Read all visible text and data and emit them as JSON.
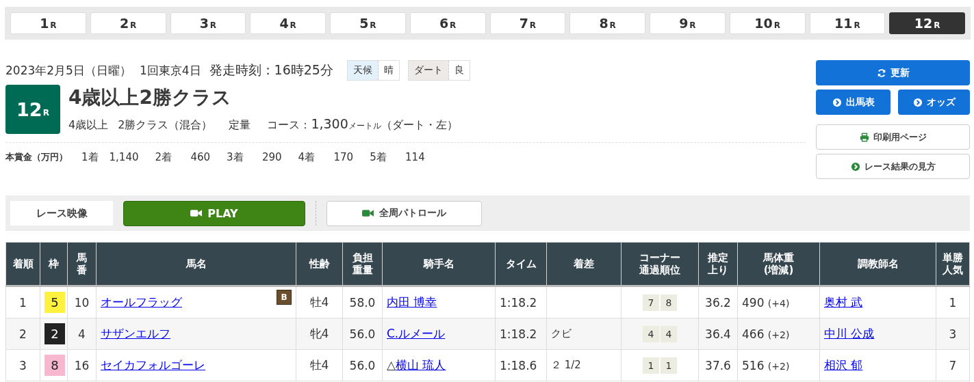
{
  "race_tabs": [
    {
      "number": "1",
      "suffix": "R",
      "selected": false
    },
    {
      "number": "2",
      "suffix": "R",
      "selected": false
    },
    {
      "number": "3",
      "suffix": "R",
      "selected": false
    },
    {
      "number": "4",
      "suffix": "R",
      "selected": false
    },
    {
      "number": "5",
      "suffix": "R",
      "selected": false
    },
    {
      "number": "6",
      "suffix": "R",
      "selected": false
    },
    {
      "number": "7",
      "suffix": "R",
      "selected": false
    },
    {
      "number": "8",
      "suffix": "R",
      "selected": false
    },
    {
      "number": "9",
      "suffix": "R",
      "selected": false
    },
    {
      "number": "10",
      "suffix": "R",
      "selected": false
    },
    {
      "number": "11",
      "suffix": "R",
      "selected": false
    },
    {
      "number": "12",
      "suffix": "R",
      "selected": true
    }
  ],
  "race_info": {
    "date": "2023年2月5日（日曜）",
    "meeting": "1回東京4日",
    "start_time": "発走時刻：16時25分",
    "weather": {
      "label": "天候",
      "value": "晴"
    },
    "track": {
      "label": "ダート",
      "value": "良"
    },
    "race_number": {
      "number": "12",
      "suffix": "R"
    },
    "race_name": "4歳以上2勝クラス",
    "conditions": [
      "4歳以上",
      "2勝クラス（混合）",
      "定量"
    ],
    "course": {
      "label": "コース：",
      "distance": "1,300",
      "unit": "メートル",
      "detail": "（ダート・左）"
    },
    "prize_label": "本賞金（万円）",
    "prizes": [
      {
        "place": "1着",
        "amount": "1,140"
      },
      {
        "place": "2着",
        "amount": "460"
      },
      {
        "place": "3着",
        "amount": "290"
      },
      {
        "place": "4着",
        "amount": "170"
      },
      {
        "place": "5着",
        "amount": "114"
      }
    ]
  },
  "side_buttons": [
    {
      "label": "更新",
      "kind": "refresh"
    },
    {
      "label": "出馬表",
      "kind": "link"
    },
    {
      "label": "オッズ",
      "kind": "link"
    },
    {
      "label": "印刷用ページ",
      "kind": "print"
    },
    {
      "label": "レース結果の見方",
      "kind": "guide"
    }
  ],
  "video": {
    "label": "レース映像",
    "play": "PLAY",
    "patrol": "全周パトロール"
  },
  "table": {
    "columns": [
      [
        "着順"
      ],
      [
        "枠"
      ],
      [
        "馬",
        "番"
      ],
      [
        "馬名"
      ],
      [
        "性齢"
      ],
      [
        "負担",
        "重量"
      ],
      [
        "騎手名"
      ],
      [
        "タイム"
      ],
      [
        "着差"
      ],
      [
        "コーナー",
        "通過順位"
      ],
      [
        "推定",
        "上り"
      ],
      [
        "馬体重",
        "(増減)"
      ],
      [
        "調教師名"
      ],
      [
        "単勝",
        "人気"
      ]
    ],
    "rows": [
      {
        "place": "1",
        "frame": "5",
        "color": "#fff23e",
        "number": "10",
        "horse": "オールフラッグ",
        "blinkers": "B",
        "sex_age": "牡4",
        "weight": "58.0",
        "jockey_mark": "",
        "jockey": "内田 博幸",
        "time": "1:18.2",
        "margin": "",
        "corners": [
          "7",
          "8"
        ],
        "last3f": "36.2",
        "body_weight": "490",
        "weight_change": "(+4)",
        "trainer": "奥村 武",
        "popularity": "1"
      },
      {
        "place": "2",
        "frame": "2",
        "color": "#222222",
        "number": "4",
        "horse": "サザンエルフ",
        "blinkers": "",
        "sex_age": "牝4",
        "weight": "56.0",
        "jockey_mark": "",
        "jockey": "C.ルメール",
        "time": "1:18.2",
        "margin": "クビ",
        "corners": [
          "4",
          "4"
        ],
        "last3f": "36.4",
        "body_weight": "466",
        "weight_change": "(+2)",
        "trainer": "中川 公成",
        "popularity": "3"
      },
      {
        "place": "3",
        "frame": "8",
        "color": "#f7b7cf",
        "number": "16",
        "horse": "セイカフォルゴーレ",
        "blinkers": "",
        "sex_age": "牡4",
        "weight": "56.0",
        "jockey_mark": "△",
        "jockey": "横山 琉人",
        "time": "1:18.6",
        "margin": "２ 1/2",
        "corners": [
          "1",
          "1"
        ],
        "last3f": "37.6",
        "body_weight": "516",
        "weight_change": "(+2)",
        "trainer": "相沢 郁",
        "popularity": "7"
      }
    ]
  }
}
